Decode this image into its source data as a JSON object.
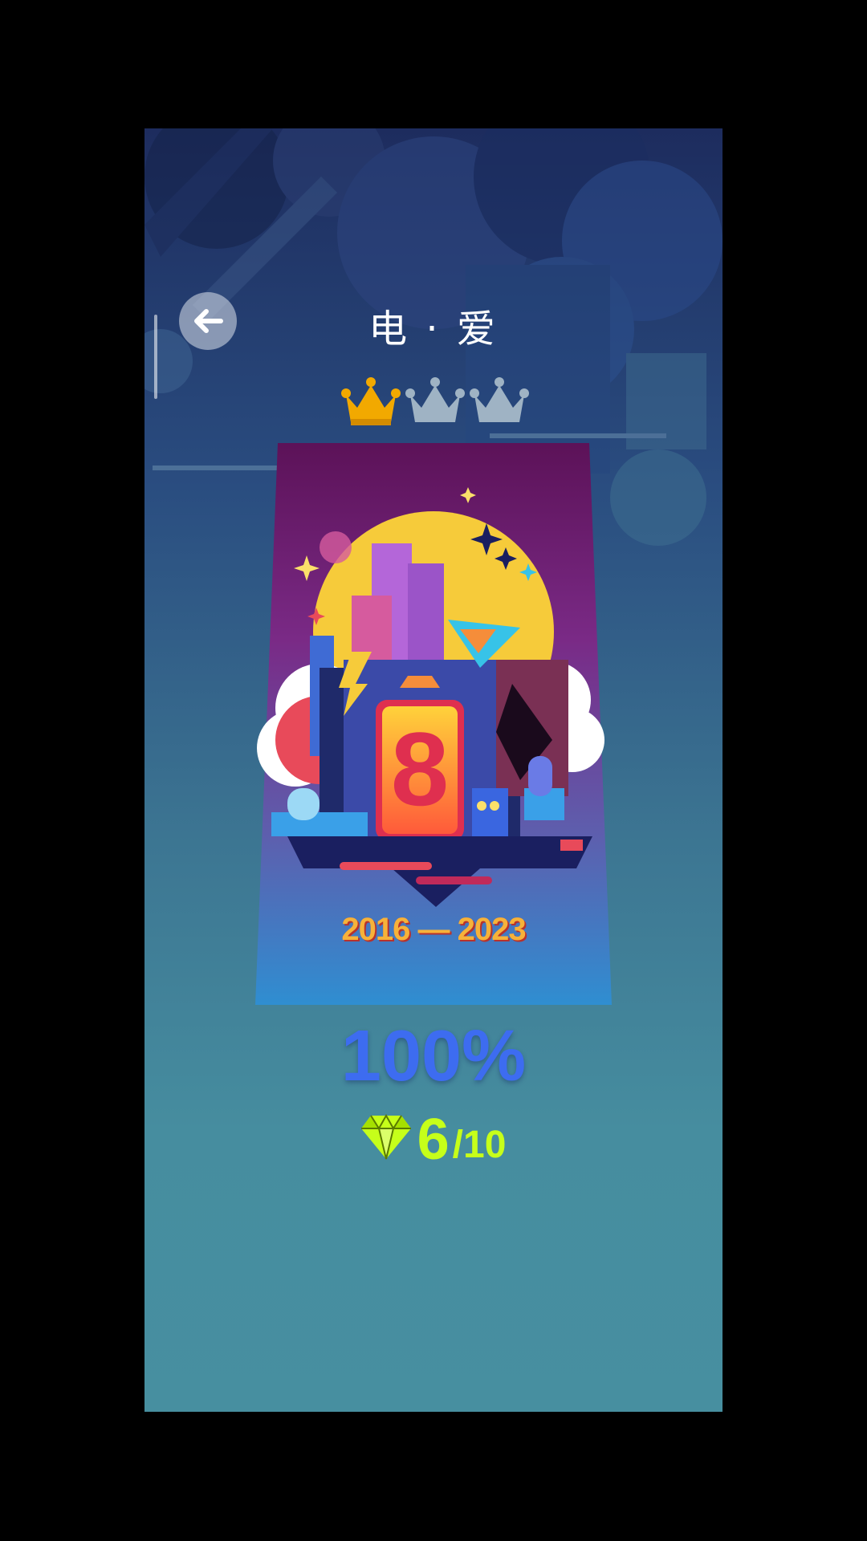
{
  "level": {
    "title": "电 · 爱",
    "crowns_earned": 1,
    "crowns_total": 3,
    "cover_years": "2016 — 2023",
    "cover_number": "8"
  },
  "progress": {
    "percent_label": "100%"
  },
  "gems": {
    "collected": "6",
    "separator": "/",
    "total": "10"
  },
  "colors": {
    "crown_earned": "#f2a900",
    "crown_empty": "#9fb3c4",
    "progress_text": "#3d6cf0",
    "gem_text": "#c6ff1a"
  },
  "icons": {
    "back": "arrow-left-icon",
    "crown": "crown-icon",
    "gem": "diamond-icon"
  }
}
